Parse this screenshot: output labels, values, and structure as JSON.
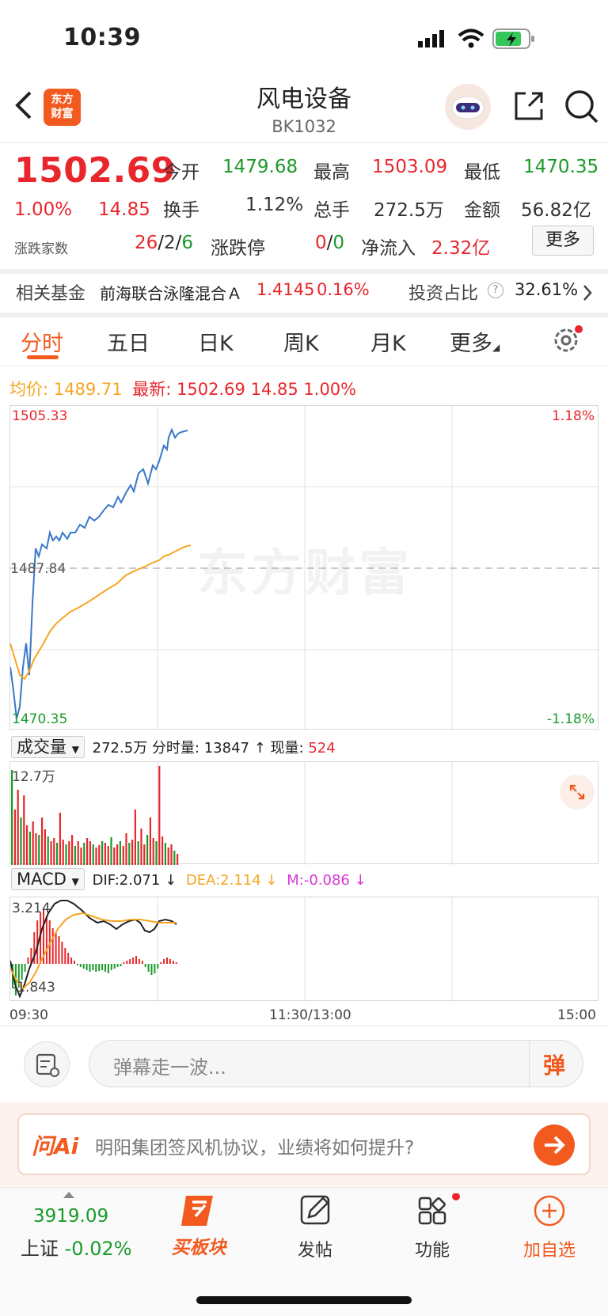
{
  "status": {
    "time": "10:39"
  },
  "header": {
    "logo_text": "东方财富",
    "title": "风电设备",
    "code": "BK1032"
  },
  "quote": {
    "price": "1502.69",
    "pct": "1.00%",
    "change": "14.85",
    "open_label": "今开",
    "open": "1479.68",
    "high_label": "最高",
    "high": "1503.09",
    "low_label": "最低",
    "low": "1470.35",
    "turnover_label": "换手",
    "turnover": "1.12%",
    "volume_label": "总手",
    "volume": "272.5万",
    "amount_label": "金额",
    "amount": "56.82亿",
    "breadth_label": "涨跌家数",
    "up": "26",
    "flat": "2",
    "down": "6",
    "limit_label": "涨跌停",
    "limit_up": "0",
    "limit_down": "0",
    "inflow_label": "净流入",
    "inflow": "2.32亿",
    "more": "更多"
  },
  "fund": {
    "label": "相关基金",
    "name": "前海联合泳隆混合Ａ",
    "nav": "1.4145",
    "pct": "0.16%",
    "ratio_label": "投资占比",
    "ratio": "32.61%"
  },
  "tabs": [
    "分时",
    "五日",
    "日K",
    "周K",
    "月K",
    "更多"
  ],
  "chart": {
    "avg_label": "均价:",
    "avg": "1489.71",
    "last_label": "最新:",
    "last": "1502.69",
    "last_change": "14.85",
    "last_pct": "1.00%",
    "y_top": "1505.33",
    "y_mid": "1487.84",
    "y_bot": "1470.35",
    "pct_top": "1.18%",
    "pct_bot": "-1.18%",
    "watermark": "东方财富",
    "vol_select": "成交量",
    "vol_total": "272.5万",
    "vol_tick_label": "分时量:",
    "vol_tick": "13847",
    "vol_now_label": "现量:",
    "vol_now": "524",
    "vol_max": "12.7万",
    "macd_select": "MACD",
    "dif": "DIF:2.071",
    "dea": "DEA:2.114",
    "m": "M:-0.086",
    "macd_top": "3.214",
    "macd_bot": "-1.843",
    "time_start": "09:30",
    "time_mid": "11:30/13:00",
    "time_end": "15:00"
  },
  "danmu": {
    "placeholder": "弹幕走一波...",
    "btn": "弹"
  },
  "ai": {
    "logo": "问Ai",
    "question": "明阳集团签风机协议，业绩将如何提升?"
  },
  "bottom": {
    "index_value": "3919.09",
    "index_name": "上证",
    "index_pct": "-0.02%",
    "buy": "买板块",
    "post": "发帖",
    "func": "功能",
    "add": "加自选"
  },
  "colors": {
    "up": "#e8262c",
    "down": "#1a9a2a",
    "accent": "#f25a1f",
    "price_line": "#3a78c8",
    "avg_line": "#f5a623"
  }
}
